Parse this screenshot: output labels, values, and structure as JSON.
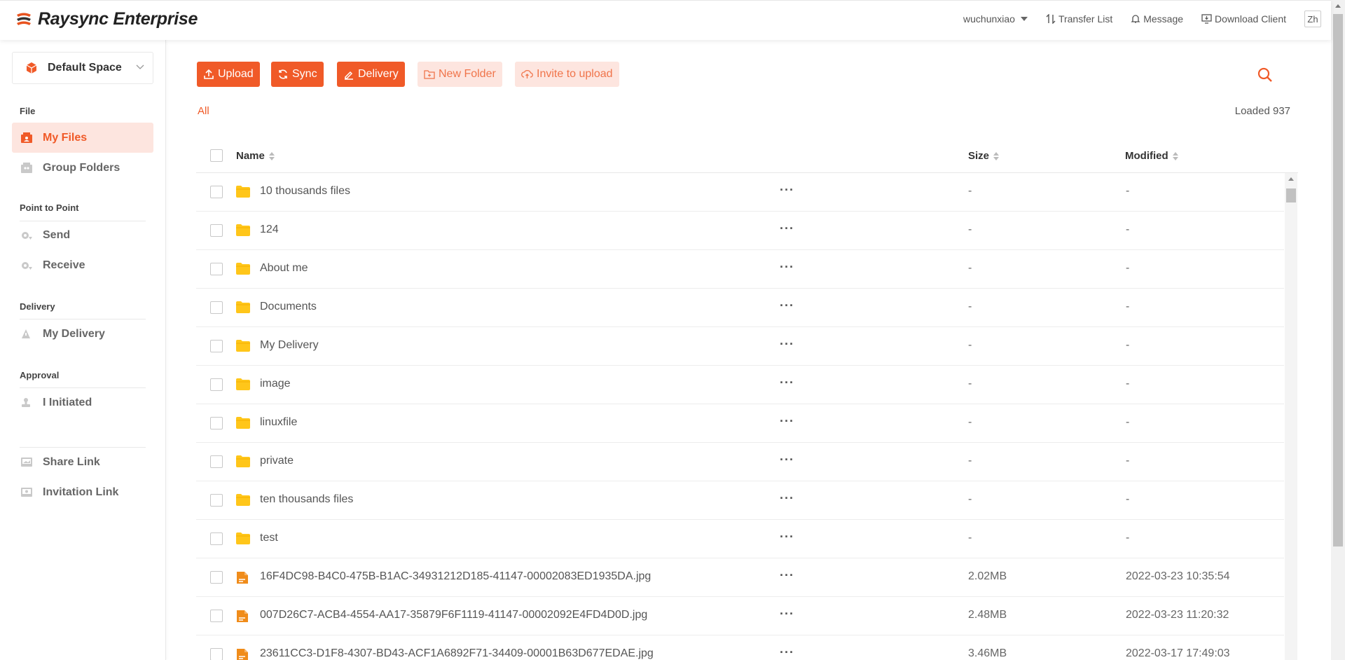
{
  "header": {
    "app_name": "Raysync Enterprise",
    "username": "wuchunxiao",
    "transfer_list": "Transfer List",
    "message": "Message",
    "download_client": "Download Client",
    "lang": "Zh"
  },
  "sidebar": {
    "space": "Default Space",
    "sections": {
      "file": "File",
      "p2p": "Point to Point",
      "delivery": "Delivery",
      "approval": "Approval"
    },
    "items": {
      "my_files": "My Files",
      "group_folders": "Group Folders",
      "send": "Send",
      "receive": "Receive",
      "my_delivery": "My Delivery",
      "i_initiated": "I Initiated",
      "share_link": "Share Link",
      "invitation_link": "Invitation Link"
    }
  },
  "toolbar": {
    "upload": "Upload",
    "sync": "Sync",
    "delivery": "Delivery",
    "new_folder": "New Folder",
    "invite": "Invite to upload"
  },
  "breadcrumb": "All",
  "loaded": "Loaded 937",
  "table": {
    "columns": {
      "name": "Name",
      "size": "Size",
      "modified": "Modified"
    },
    "rows": [
      {
        "type": "folder",
        "name": "10 thousands files",
        "size": "-",
        "modified": "-"
      },
      {
        "type": "folder",
        "name": "124",
        "size": "-",
        "modified": "-"
      },
      {
        "type": "folder",
        "name": "About me",
        "size": "-",
        "modified": "-"
      },
      {
        "type": "folder",
        "name": "Documents",
        "size": "-",
        "modified": "-"
      },
      {
        "type": "folder",
        "name": "My Delivery",
        "size": "-",
        "modified": "-"
      },
      {
        "type": "folder",
        "name": "image",
        "size": "-",
        "modified": "-"
      },
      {
        "type": "folder",
        "name": "linuxfile",
        "size": "-",
        "modified": "-"
      },
      {
        "type": "folder",
        "name": "private",
        "size": "-",
        "modified": "-"
      },
      {
        "type": "folder",
        "name": "ten thousands files",
        "size": "-",
        "modified": "-"
      },
      {
        "type": "folder",
        "name": "test",
        "size": "-",
        "modified": "-"
      },
      {
        "type": "file",
        "name": "16F4DC98-B4C0-475B-B1AC-34931212D185-41147-00002083ED1935DA.jpg",
        "size": "2.02MB",
        "modified": "2022-03-23 10:35:54"
      },
      {
        "type": "file",
        "name": "007D26C7-ACB4-4554-AA17-35879F6F1119-41147-00002092E4FD4D0D.jpg",
        "size": "2.48MB",
        "modified": "2022-03-23 11:20:32"
      },
      {
        "type": "file",
        "name": "23611CC3-D1F8-4307-BD43-ACF1A6892F71-34409-00001B63D677EDAE.jpg",
        "size": "3.46MB",
        "modified": "2022-03-17 17:49:03"
      }
    ]
  },
  "colors": {
    "accent": "#f05a28",
    "accent_light": "#fde5df",
    "folder": "#ffc61a",
    "file": "#f08c1a"
  }
}
